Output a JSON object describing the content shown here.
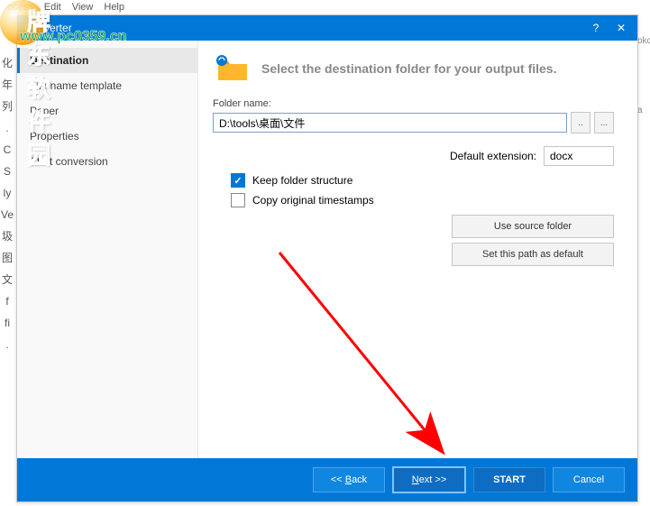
{
  "menubar": [
    "ocess",
    "Edit",
    "View",
    "Help"
  ],
  "watermark": {
    "cn": "牌东软件园",
    "url": "www.pc0359.cn"
  },
  "titlebar": {
    "title": "Converter",
    "help": "?",
    "close": "✕"
  },
  "sidebar": {
    "items": [
      {
        "label": "Destination",
        "active": true
      },
      {
        "label": "File name template",
        "active": false
      },
      {
        "label": "Paper",
        "active": false
      },
      {
        "label": "Properties",
        "active": false
      },
      {
        "label": "Start conversion",
        "active": false
      }
    ]
  },
  "content": {
    "header": "Select the destination folder for your output files.",
    "folder_label": "Folder name:",
    "folder_path": "D:\\tools\\桌面\\文件",
    "ext_label": "Default extension:",
    "ext_value": "docx",
    "keep_structure": "Keep folder structure",
    "copy_timestamps": "Copy original timestamps",
    "use_source": "Use source folder",
    "set_default": "Set this path as default"
  },
  "footer": {
    "back": "<< Back",
    "next_prefix": "N",
    "next_rest": "ext >>",
    "start": "START",
    "cancel": "Cancel"
  }
}
